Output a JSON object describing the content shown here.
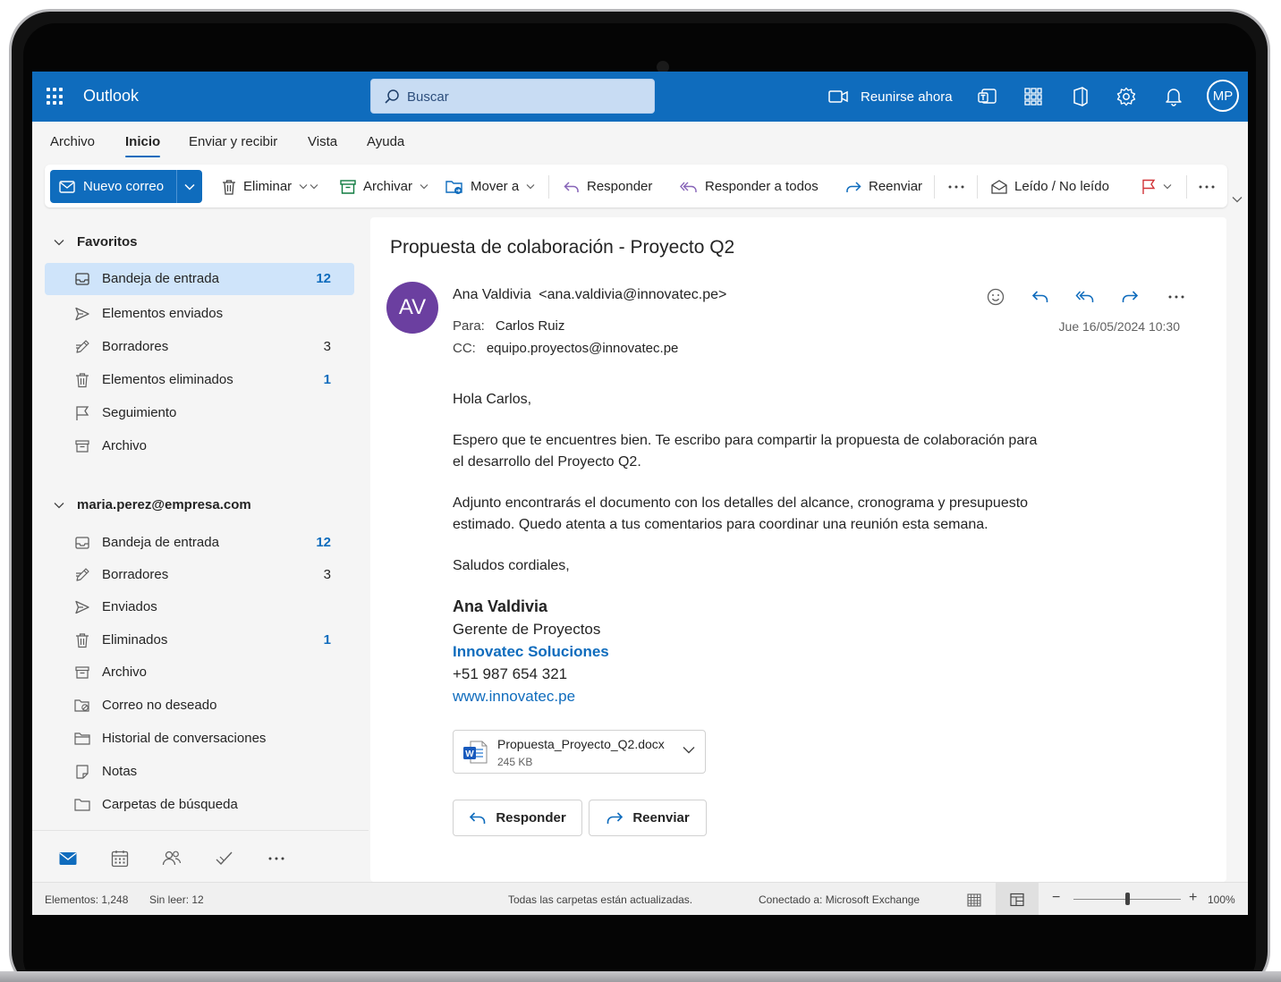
{
  "app": {
    "name": "Outlook"
  },
  "search": {
    "placeholder": "Buscar"
  },
  "topbar": {
    "meet_label": "Reunirse ahora",
    "user_initials": "MP"
  },
  "menu": {
    "tabs": [
      "Archivo",
      "Inicio",
      "Enviar y recibir",
      "Vista",
      "Ayuda"
    ],
    "active": "Inicio"
  },
  "ribbon": {
    "new_mail": "Nuevo correo",
    "delete": "Eliminar",
    "archive": "Archivar",
    "move": "Mover a",
    "reply": "Responder",
    "reply_all": "Responder a todos",
    "forward": "Reenviar",
    "read_unread": "Leído / No leído"
  },
  "folders": {
    "favorites": {
      "title": "Favoritos",
      "items": [
        {
          "label": "Bandeja de entrada",
          "count": "12",
          "icon": "inbox-icon"
        },
        {
          "label": "Elementos enviados",
          "count": "",
          "icon": "send-icon"
        },
        {
          "label": "Borradores",
          "count": "3",
          "icon": "draft-icon"
        },
        {
          "label": "Elementos eliminados",
          "count": "1",
          "icon": "trash-icon"
        },
        {
          "label": "Seguimiento",
          "count": "",
          "icon": "flag-icon"
        },
        {
          "label": "Archivo",
          "count": "",
          "icon": "archive-icon"
        }
      ]
    },
    "account": {
      "title": "maria.perez@empresa.com",
      "items": [
        {
          "label": "Bandeja de entrada",
          "count": "12",
          "icon": "inbox-icon"
        },
        {
          "label": "Borradores",
          "count": "3",
          "icon": "draft-icon"
        },
        {
          "label": "Enviados",
          "count": "",
          "icon": "send-icon"
        },
        {
          "label": "Eliminados",
          "count": "1",
          "icon": "trash-icon"
        },
        {
          "label": "Archivo",
          "count": "",
          "icon": "archive-icon"
        },
        {
          "label": "Correo no deseado",
          "count": "",
          "icon": "junk-icon"
        },
        {
          "label": "Historial de conversaciones",
          "count": "",
          "icon": "folder-icon"
        },
        {
          "label": "Notas",
          "count": "",
          "icon": "note-icon"
        },
        {
          "label": "Carpetas de búsqueda",
          "count": "",
          "icon": "search-folder-icon"
        }
      ]
    }
  },
  "message": {
    "subject": "Propuesta de colaboración - Proyecto Q2",
    "sender_initials": "AV",
    "sender_name": "Ana Valdivia",
    "sender_email": "<ana.valdivia@innovatec.pe>",
    "to_label": "Para:",
    "to": "Carlos Ruiz",
    "cc_label": "CC:",
    "cc": "equipo.proyectos@innovatec.pe",
    "date": "Jue 16/05/2024 10:30",
    "greeting": "Hola Carlos,",
    "paragraph1": "Espero que te encuentres bien. Te escribo para compartir la propuesta de colaboración para el desarrollo del Proyecto Q2.",
    "paragraph2": "Adjunto encontrarás el documento con los detalles del alcance, cronograma y presupuesto estimado. Quedo atenta a tus comentarios para coordinar una reunión esta semana.",
    "closing": "Saludos cordiales,",
    "signature": {
      "name": "Ana Valdivia",
      "title": "Gerente de Proyectos",
      "company": "Innovatec Soluciones",
      "phone": "+51 987 654 321",
      "web": "www.innovatec.pe"
    },
    "attachment": {
      "name": "Propuesta_Proyecto_Q2.docx",
      "size": "245 KB"
    },
    "reply_button": "Responder",
    "forward_button": "Reenviar"
  },
  "status": {
    "items": "Elementos: 1,248",
    "unread": "Sin leer: 12",
    "sync": "Todas las carpetas están actualizadas.",
    "connection": "Conectado a: Microsoft Exchange",
    "zoom": "100%",
    "zoom_level": 1.0
  },
  "colors": {
    "brand": "#0f6cbd",
    "selected_folder": "#cfe4fa",
    "sender_avatar": "#6b3fa0",
    "flag": "#d13438"
  }
}
